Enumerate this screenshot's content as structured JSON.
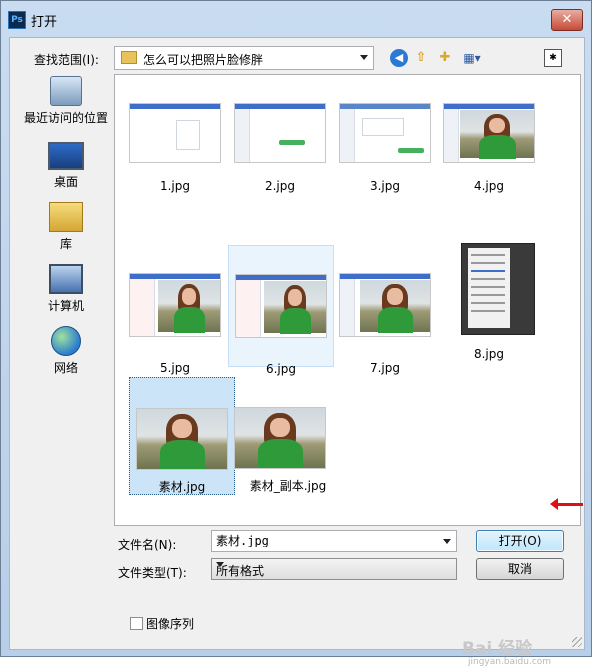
{
  "window": {
    "title": "打开"
  },
  "toolbar": {
    "lookin_label": "查找范围(I):",
    "lookin_value": "怎么可以把照片脸修胖"
  },
  "places": [
    {
      "label": "最近访问的位置"
    },
    {
      "label": "桌面"
    },
    {
      "label": "库"
    },
    {
      "label": "计算机"
    },
    {
      "label": "网络"
    }
  ],
  "files": [
    {
      "name": "1.jpg"
    },
    {
      "name": "2.jpg"
    },
    {
      "name": "3.jpg"
    },
    {
      "name": "4.jpg"
    },
    {
      "name": "5.jpg"
    },
    {
      "name": "6.jpg"
    },
    {
      "name": "7.jpg"
    },
    {
      "name": "8.jpg"
    },
    {
      "name": "素材.jpg"
    },
    {
      "name": "素材_副本.jpg"
    }
  ],
  "bottom": {
    "filename_label": "文件名(N):",
    "filename_value": "素材.jpg",
    "filetype_label": "文件类型(T):",
    "filetype_value": "所有格式",
    "open_label": "打开(O)",
    "cancel_label": "取消",
    "sequence_label": "图像序列"
  },
  "watermark": {
    "brand": "Bai 经验",
    "url": "jingyan.baidu.com"
  },
  "colors": {
    "selection": "#cce4f7",
    "accent": "#3c7fb1",
    "arrow": "#dd1111"
  }
}
